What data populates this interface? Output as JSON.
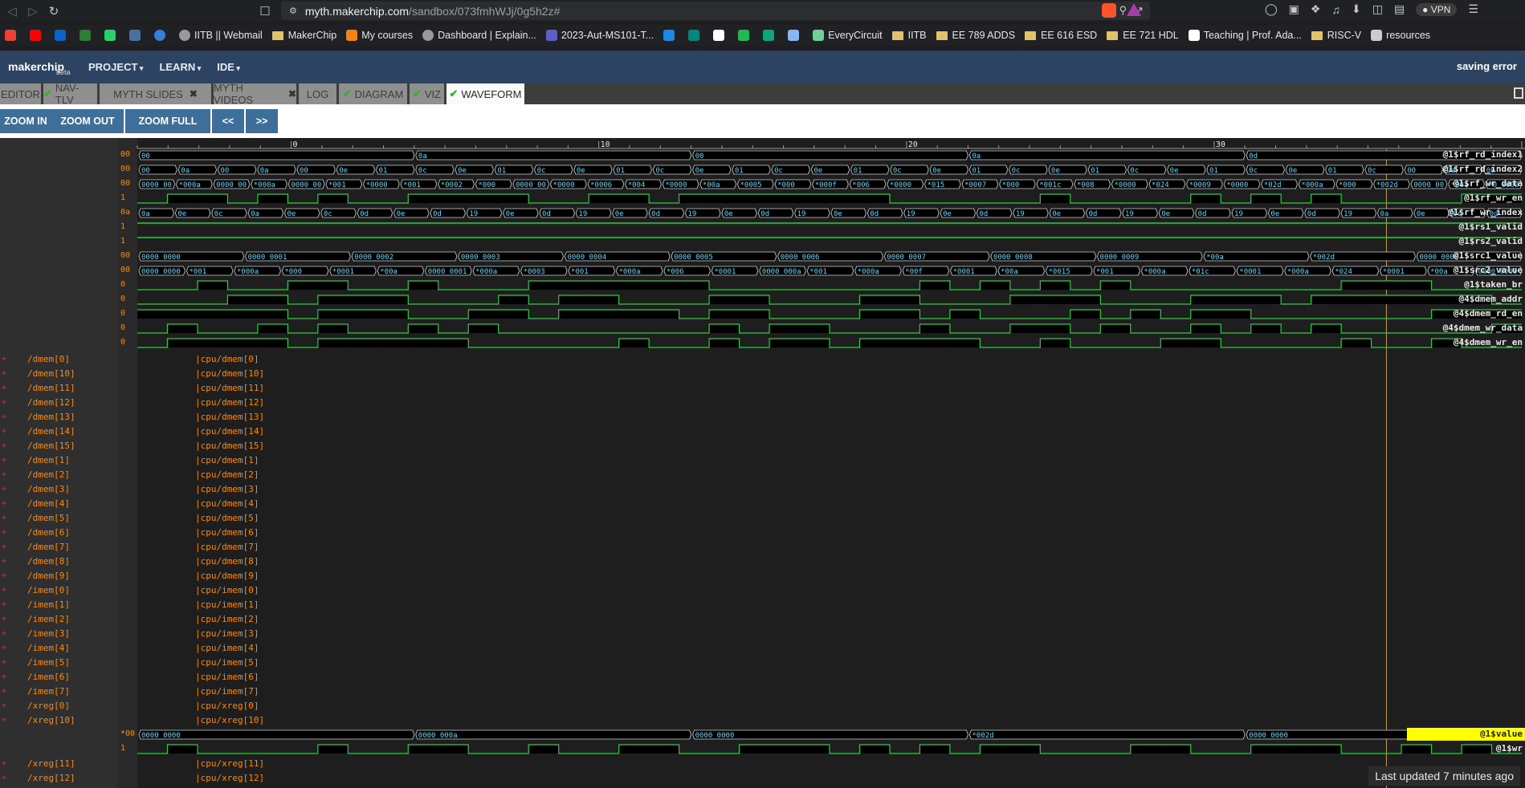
{
  "browser": {
    "url_host": "myth.makerchip.com",
    "url_path": "/sandbox/073fmhWJj/0g5h2z#",
    "vpn_label": "VPN"
  },
  "bookmarks": [
    {
      "label": "",
      "icon": "gmail-icon",
      "color": "#ea4335"
    },
    {
      "label": "",
      "icon": "youtube-icon",
      "color": "#ff0000"
    },
    {
      "label": "",
      "icon": "outlook-icon",
      "color": "#0a64c8"
    },
    {
      "label": "",
      "icon": "chip-icon",
      "color": "#2e7d32"
    },
    {
      "label": "",
      "icon": "whatsapp-icon",
      "color": "#25d366"
    },
    {
      "label": "",
      "icon": "iitb-logo-icon",
      "color": "#4a6fa5"
    },
    {
      "label": "",
      "icon": "circle-icon",
      "color": "#3b7dd8"
    },
    {
      "label": "IITB || Webmail",
      "icon": "globe-icon",
      "color": "#999999"
    },
    {
      "label": "MakerChip",
      "icon": "folder-icon",
      "color": "#e2c16b"
    },
    {
      "label": "My courses",
      "icon": "moodle-icon",
      "color": "#f98012"
    },
    {
      "label": "Dashboard | Explain...",
      "icon": "globe-icon",
      "color": "#999999"
    },
    {
      "label": "2023-Aut-MS101-T...",
      "icon": "ms-icon",
      "color": "#5b5fc7"
    },
    {
      "label": "",
      "icon": "play-icon",
      "color": "#1e88e5"
    },
    {
      "label": "",
      "icon": "meet-icon",
      "color": "#00897b"
    },
    {
      "label": "",
      "icon": "github-icon",
      "color": "#ffffff"
    },
    {
      "label": "",
      "icon": "spotify-icon",
      "color": "#1db954"
    },
    {
      "label": "",
      "icon": "chatgpt-icon",
      "color": "#10a37f"
    },
    {
      "label": "",
      "icon": "sparkle-icon",
      "color": "#8ab4f8"
    },
    {
      "label": "EveryCircuit",
      "icon": "everycircuit-icon",
      "color": "#6fcf97"
    },
    {
      "label": "IITB",
      "icon": "folder-icon",
      "color": "#e2c16b"
    },
    {
      "label": "EE 789 ADDS",
      "icon": "folder-icon",
      "color": "#e2c16b"
    },
    {
      "label": "EE 616 ESD",
      "icon": "folder-icon",
      "color": "#e2c16b"
    },
    {
      "label": "EE 721 HDL",
      "icon": "folder-icon",
      "color": "#e2c16b"
    },
    {
      "label": "Teaching | Prof. Ada...",
      "icon": "site-icon",
      "color": "#ffffff"
    },
    {
      "label": "RISC-V",
      "icon": "folder-icon",
      "color": "#e2c16b"
    },
    {
      "label": "resources",
      "icon": "site-icon",
      "color": "#cccccc"
    }
  ],
  "header": {
    "logo": "makerchip",
    "beta": "beta",
    "menus": [
      "PROJECT",
      "LEARN",
      "IDE"
    ],
    "status": "saving error"
  },
  "tabs": [
    {
      "label": "EDITOR",
      "check": false,
      "close": false,
      "active": false
    },
    {
      "label": "NAV-TLV",
      "check": true,
      "close": false,
      "active": false
    },
    {
      "label": "MYTH SLIDES",
      "check": false,
      "close": true,
      "active": false
    },
    {
      "label": "MYTH VIDEOS",
      "check": false,
      "close": true,
      "active": false
    },
    {
      "label": "LOG",
      "check": false,
      "close": false,
      "active": false
    },
    {
      "label": "DIAGRAM",
      "check": true,
      "close": false,
      "active": false
    },
    {
      "label": "VIZ",
      "check": true,
      "close": false,
      "active": false
    },
    {
      "label": "WAVEFORM",
      "check": true,
      "close": false,
      "active": true
    }
  ],
  "toolbar": {
    "zoom_in": "ZOOM IN",
    "zoom_out": "ZOOM OUT",
    "zoom_full": "ZOOM FULL",
    "prev": "<<",
    "next": ">>"
  },
  "ruler_labels": [
    "0",
    "10",
    "20",
    "30"
  ],
  "signals": [
    {
      "name": "@1$rf_rd_index1",
      "val": "00",
      "kind": "bus",
      "segs": [
        "00",
        "0a",
        "00",
        "0a",
        "0d"
      ]
    },
    {
      "name": "@1$rf_rd_index2",
      "val": "00",
      "kind": "bus",
      "segs": [
        "00",
        "0a",
        "00",
        "0a",
        "00",
        "0e",
        "01",
        "0c",
        "0e",
        "01",
        "0c",
        "0e",
        "01",
        "0c",
        "0e",
        "01",
        "0c",
        "0e",
        "01",
        "0c",
        "0e",
        "01",
        "0c",
        "0e",
        "01",
        "0c",
        "0e",
        "01",
        "0c",
        "0e",
        "01",
        "0c",
        "00",
        "0a",
        "00"
      ]
    },
    {
      "name": "@1$rf_wr_data",
      "val": "00",
      "kind": "bus",
      "segs": [
        "0000_0000",
        "*000a",
        "0000_0000",
        "*000a",
        "0000_0000",
        "*001",
        "*0000",
        "*001",
        "*0002",
        "*000",
        "0000_0003",
        "*0000",
        "*0006",
        "*004",
        "*0000",
        "*00a",
        "*0005",
        "*000",
        "*000f",
        "*006",
        "*0000",
        "*015",
        "*0007",
        "*000",
        "*001c",
        "*008",
        "*0000",
        "*024",
        "*0009",
        "*0000",
        "*02d",
        "*000a",
        "*000",
        "*002d",
        "0000_0000",
        "*00a",
        "*0_0000"
      ]
    },
    {
      "name": "@1$rf_wr_en",
      "val": "1",
      "kind": "bit"
    },
    {
      "name": "@1$rf_wr_index",
      "val": "0a",
      "kind": "bus",
      "segs": [
        "0a",
        "0e",
        "0c",
        "0a",
        "0e",
        "0c",
        "0d",
        "0e",
        "0d",
        "19",
        "0e",
        "0d",
        "19",
        "0e",
        "0d",
        "19",
        "0e",
        "0d",
        "19",
        "0e",
        "0d",
        "19",
        "0e",
        "0d",
        "19",
        "0e",
        "0d",
        "19",
        "0e",
        "0d",
        "19",
        "0e",
        "0d",
        "19",
        "0a",
        "0e",
        "0c",
        "0d"
      ]
    },
    {
      "name": "@1$rs1_valid",
      "val": "1",
      "kind": "flat"
    },
    {
      "name": "@1$rs2_valid",
      "val": "1",
      "kind": "flat"
    },
    {
      "name": "@1$src1_value",
      "val": "00",
      "kind": "bus",
      "segs": [
        "0000_0000",
        "0000_0001",
        "0000_0002",
        "0000_0003",
        "0000_0004",
        "0000_0005",
        "0000_0006",
        "0000_0007",
        "0000_0008",
        "0000_0009",
        "*00a",
        "*002d",
        "0000_0000"
      ]
    },
    {
      "name": "@1$src2_value",
      "val": "00",
      "kind": "bus",
      "segs": [
        "0000_0000",
        "*001",
        "*000a",
        "*000",
        "*0001",
        "*00a",
        "0000_0001",
        "*000a",
        "*0003",
        "*001",
        "*000a",
        "*006",
        "*0001",
        "0000_000a",
        "*001",
        "*000a",
        "*00f",
        "*0001",
        "*00a",
        "*0015",
        "*001",
        "*000a",
        "*01c",
        "*0001",
        "*000a",
        "*024",
        "*0001",
        "*00a",
        "0000_0000"
      ]
    },
    {
      "name": "@1$taken_br",
      "val": "0",
      "kind": "bit"
    },
    {
      "name": "@4$dmem_addr",
      "val": "0",
      "kind": "bit"
    },
    {
      "name": "@4$dmem_rd_en",
      "val": "0",
      "kind": "bit"
    },
    {
      "name": "@4$dmem_wr_data",
      "val": "0",
      "kind": "bit"
    },
    {
      "name": "@4$dmem_wr_en",
      "val": "0",
      "kind": "bit"
    }
  ],
  "scope_rows": [
    {
      "name": "/dmem[0]",
      "path": "|cpu/dmem[0]"
    },
    {
      "name": "/dmem[10]",
      "path": "|cpu/dmem[10]"
    },
    {
      "name": "/dmem[11]",
      "path": "|cpu/dmem[11]"
    },
    {
      "name": "/dmem[12]",
      "path": "|cpu/dmem[12]"
    },
    {
      "name": "/dmem[13]",
      "path": "|cpu/dmem[13]"
    },
    {
      "name": "/dmem[14]",
      "path": "|cpu/dmem[14]"
    },
    {
      "name": "/dmem[15]",
      "path": "|cpu/dmem[15]"
    },
    {
      "name": "/dmem[1]",
      "path": "|cpu/dmem[1]"
    },
    {
      "name": "/dmem[2]",
      "path": "|cpu/dmem[2]"
    },
    {
      "name": "/dmem[3]",
      "path": "|cpu/dmem[3]"
    },
    {
      "name": "/dmem[4]",
      "path": "|cpu/dmem[4]"
    },
    {
      "name": "/dmem[5]",
      "path": "|cpu/dmem[5]"
    },
    {
      "name": "/dmem[6]",
      "path": "|cpu/dmem[6]"
    },
    {
      "name": "/dmem[7]",
      "path": "|cpu/dmem[7]"
    },
    {
      "name": "/dmem[8]",
      "path": "|cpu/dmem[8]"
    },
    {
      "name": "/dmem[9]",
      "path": "|cpu/dmem[9]"
    },
    {
      "name": "/imem[0]",
      "path": "|cpu/imem[0]"
    },
    {
      "name": "/imem[1]",
      "path": "|cpu/imem[1]"
    },
    {
      "name": "/imem[2]",
      "path": "|cpu/imem[2]"
    },
    {
      "name": "/imem[3]",
      "path": "|cpu/imem[3]"
    },
    {
      "name": "/imem[4]",
      "path": "|cpu/imem[4]"
    },
    {
      "name": "/imem[5]",
      "path": "|cpu/imem[5]"
    },
    {
      "name": "/imem[6]",
      "path": "|cpu/imem[6]"
    },
    {
      "name": "/imem[7]",
      "path": "|cpu/imem[7]"
    },
    {
      "name": "/xreg[0]",
      "path": "|cpu/xreg[0]"
    },
    {
      "name": "/xreg[10]",
      "path": "|cpu/xreg[10]"
    }
  ],
  "xreg10_signals": [
    {
      "name": "@1$value",
      "val": "*00",
      "kind": "bus",
      "highlight": true,
      "segs": [
        "0000_0000",
        "0000_000a",
        "0000_0000",
        "*002d",
        "0000_0000"
      ]
    },
    {
      "name": "@1$wr",
      "val": "1",
      "kind": "bit",
      "highlight": false
    }
  ],
  "scope_rows_after": [
    {
      "name": "/xreg[11]",
      "path": "|cpu/xreg[11]"
    },
    {
      "name": "/xreg[12]",
      "path": "|cpu/xreg[12]"
    }
  ],
  "footer": "Last updated 7 minutes ago",
  "colors": {
    "wave": "#2ecc40",
    "bus_text": "#58d8ff",
    "value": "#ff8a00",
    "cursor": "#c8a040",
    "header": "#2c4462",
    "button": "#3d6f9a"
  }
}
